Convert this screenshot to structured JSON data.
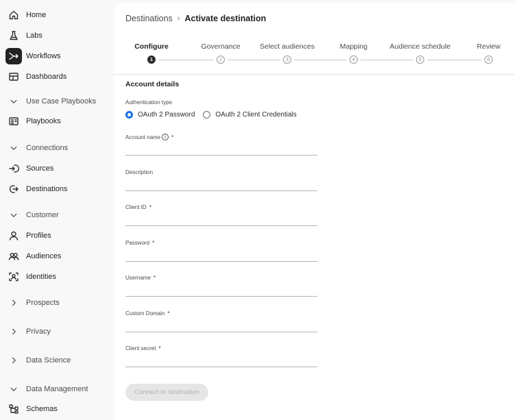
{
  "sidebar": {
    "items": [
      {
        "label": "Home",
        "icon": "home-icon",
        "kind": "item"
      },
      {
        "label": "Labs",
        "icon": "flask-icon",
        "kind": "item"
      },
      {
        "label": "Workflows",
        "icon": "workflow-icon",
        "kind": "item",
        "active": true
      },
      {
        "label": "Dashboards",
        "icon": "dashboard-icon",
        "kind": "item"
      },
      {
        "label": "Use Case Playbooks",
        "icon": "chevron-down-icon",
        "kind": "section"
      },
      {
        "label": "Playbooks",
        "icon": "playbook-icon",
        "kind": "item"
      },
      {
        "label": "Connections",
        "icon": "chevron-down-icon",
        "kind": "section"
      },
      {
        "label": "Sources",
        "icon": "sources-icon",
        "kind": "item"
      },
      {
        "label": "Destinations",
        "icon": "destinations-icon",
        "kind": "item"
      },
      {
        "label": "Customer",
        "icon": "chevron-down-icon",
        "kind": "section"
      },
      {
        "label": "Profiles",
        "icon": "profile-icon",
        "kind": "item"
      },
      {
        "label": "Audiences",
        "icon": "audiences-icon",
        "kind": "item"
      },
      {
        "label": "Identities",
        "icon": "identities-icon",
        "kind": "item"
      },
      {
        "label": "Prospects",
        "icon": "chevron-right-icon",
        "kind": "section"
      },
      {
        "label": "Privacy",
        "icon": "chevron-right-icon",
        "kind": "section"
      },
      {
        "label": "Data Science",
        "icon": "chevron-right-icon",
        "kind": "section"
      },
      {
        "label": "Data Management",
        "icon": "chevron-down-icon",
        "kind": "section"
      },
      {
        "label": "Schemas",
        "icon": "schemas-icon",
        "kind": "item"
      }
    ]
  },
  "breadcrumb": {
    "parent": "Destinations",
    "separator": "›",
    "current": "Activate destination"
  },
  "steps": [
    {
      "label": "Configure",
      "number": "1",
      "active": true
    },
    {
      "label": "Governance",
      "number": "2"
    },
    {
      "label": "Select audiences",
      "number": "3"
    },
    {
      "label": "Mapping",
      "number": "4"
    },
    {
      "label": "Audience schedule",
      "number": "5"
    },
    {
      "label": "Review",
      "number": "6"
    }
  ],
  "form": {
    "section_title": "Account details",
    "auth_label": "Authentication type",
    "auth_options": [
      {
        "label": "OAuth 2 Password",
        "checked": true
      },
      {
        "label": "OAuth 2 Client Credentials",
        "checked": false
      }
    ],
    "info_glyph": "i",
    "required_glyph": "*",
    "fields": [
      {
        "label": "Account name",
        "required": true,
        "info": true,
        "value": ""
      },
      {
        "label": "Description",
        "required": false,
        "value": ""
      },
      {
        "label": "Client ID",
        "required": true,
        "value": ""
      },
      {
        "label": "Password",
        "required": true,
        "value": ""
      },
      {
        "label": "Username",
        "required": true,
        "value": ""
      },
      {
        "label": "Custom Domain",
        "required": true,
        "value": ""
      },
      {
        "label": "Client secret",
        "required": true,
        "value": ""
      }
    ],
    "connect_label": "Connect to destination"
  },
  "colors": {
    "accent": "#1473e6",
    "active_nav": "#222222",
    "disabled_button": "#e6e6e6"
  }
}
